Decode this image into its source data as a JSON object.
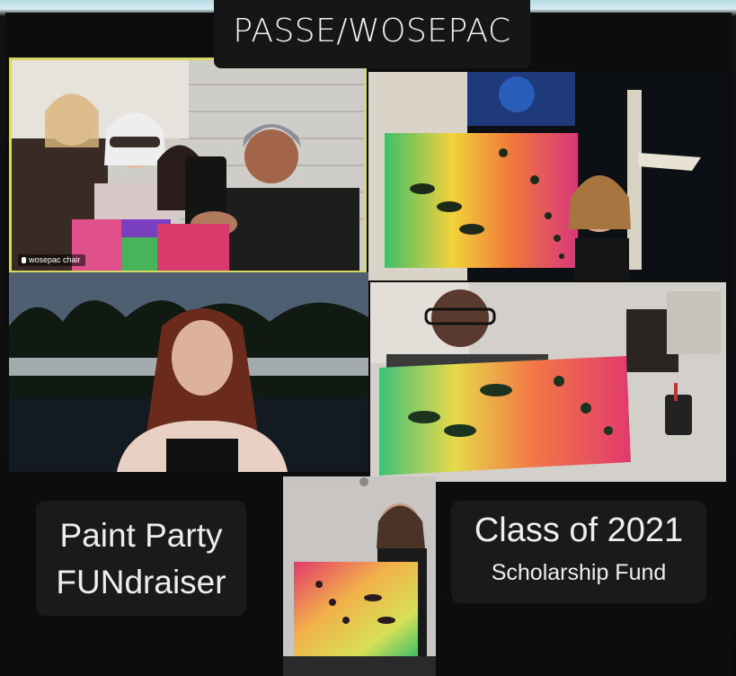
{
  "header": {
    "title": "PASSE/WOSEPAC"
  },
  "tiles": {
    "tile1": {
      "name_label": "wosepac chair"
    }
  },
  "captions": {
    "left": {
      "line1": "Paint Party",
      "line2": "FUNdraiser"
    },
    "right": {
      "line1": "Class of 2021",
      "line2": "Scholarship Fund"
    }
  }
}
